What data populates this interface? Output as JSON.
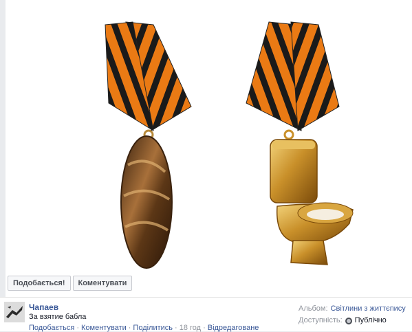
{
  "photo": {
    "subject_left": "bread-medal",
    "subject_right": "toilet-medal",
    "ribbon_colors": [
      "#1a1a1a",
      "#ea7a14"
    ]
  },
  "actions": {
    "like_label": "Подобається!",
    "comment_label": "Коментувати"
  },
  "post": {
    "author": "Чапаев",
    "caption": "За взятие бабла",
    "links": {
      "like": "Подобається",
      "comment": "Коментувати",
      "share": "Поділитись",
      "time": "18 год",
      "edited": "Відредаговане"
    }
  },
  "meta": {
    "album_label": "Альбом:",
    "album_name": "Світлини з життєпису",
    "privacy_label": "Доступність:",
    "privacy_value": "Публічно"
  }
}
